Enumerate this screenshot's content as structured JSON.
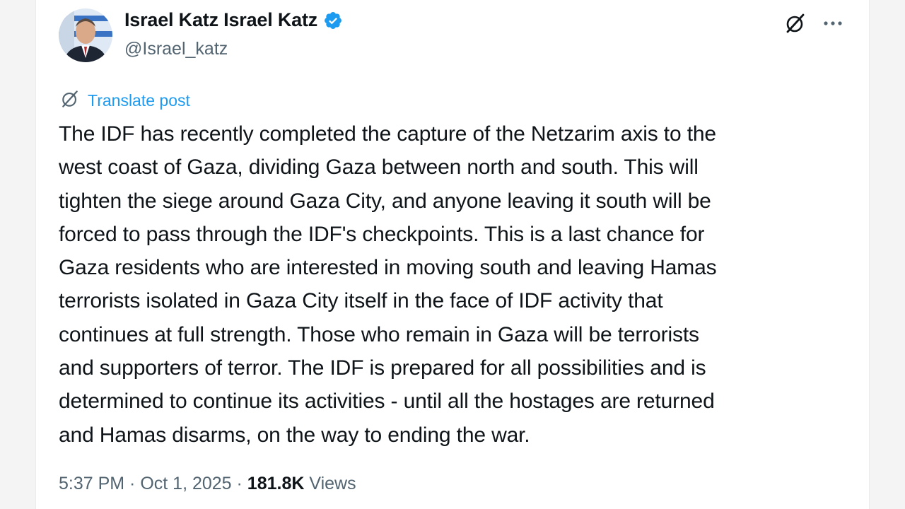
{
  "author": {
    "display_name": "Israel Katz Israel Katz",
    "handle": "@Israel_katz",
    "verified": true,
    "verified_icon": "verified-badge-icon",
    "brand_color": "#1d9bf0"
  },
  "actions": {
    "grok_icon": "grok-icon",
    "more_icon": "more-horizontal-icon"
  },
  "translate": {
    "label": "Translate post",
    "icon": "translate-icon"
  },
  "post": {
    "text": "The IDF has recently completed the capture of the Netzarim axis to the\nwest coast of Gaza, dividing Gaza between north and south. This will\ntighten the siege around Gaza City, and anyone leaving it south will be\nforced to pass through the IDF's checkpoints. This is a last chance for\nGaza residents who are interested in moving south and leaving Hamas\nterrorists isolated in Gaza City itself in the face of IDF activity that\ncontinues at full strength. Those who remain in Gaza will be terrorists\nand supporters of terror. The IDF is prepared for all possibilities and is\ndetermined to continue its activities - until all the hostages are returned\nand Hamas disarms, on the way to ending the war."
  },
  "meta": {
    "time": "5:37 PM",
    "separator": " · ",
    "date": "Oct 1, 2025",
    "views_count": "181.8K",
    "views_label": " Views"
  }
}
